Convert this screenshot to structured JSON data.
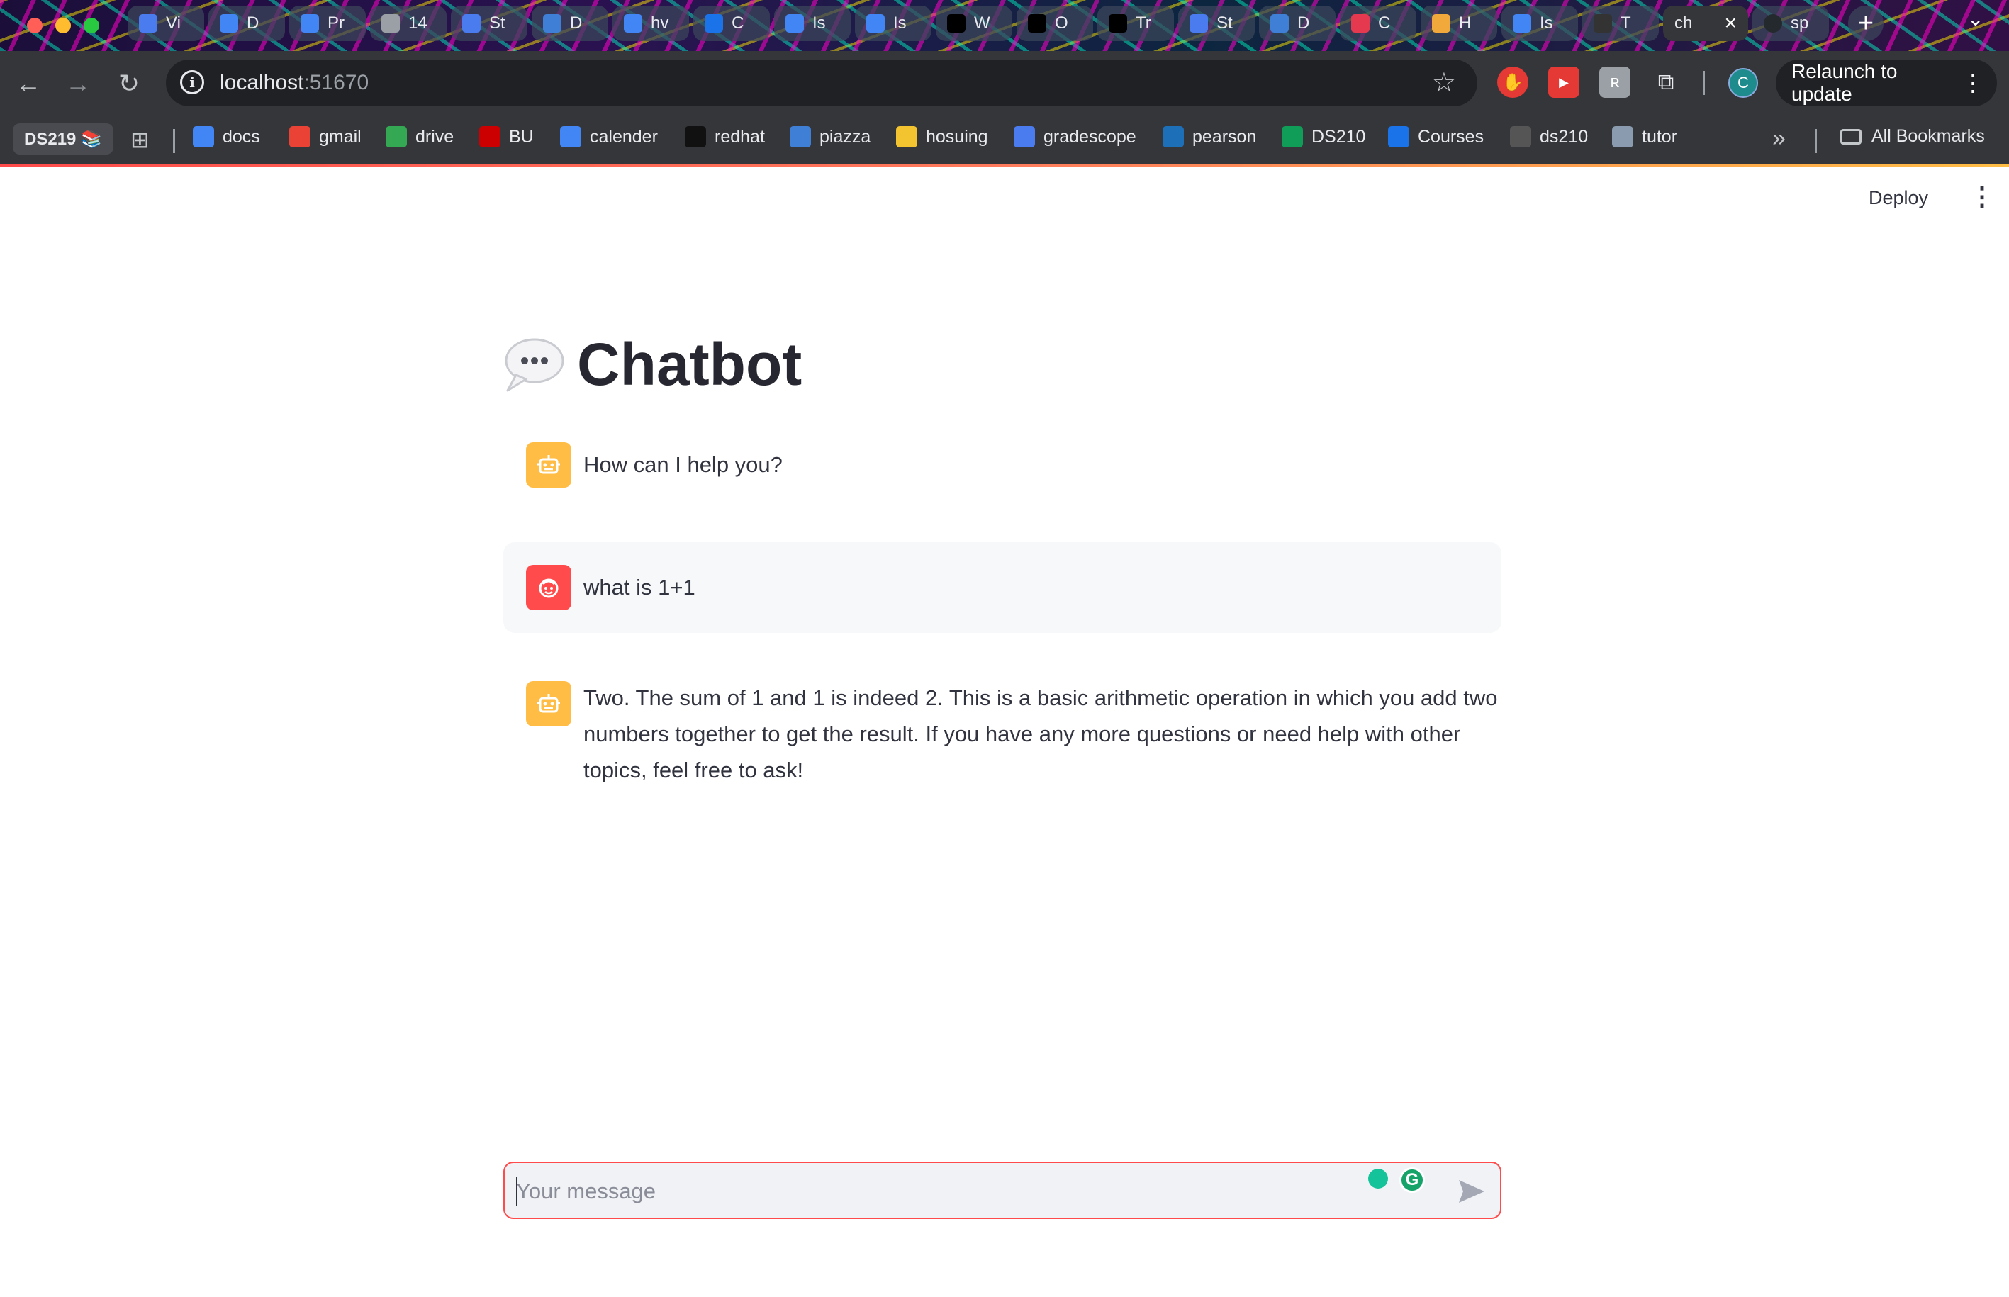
{
  "browser": {
    "tabs": [
      {
        "label": "Vi",
        "icon": "chart-bars-icon",
        "color": "#4a7cf0"
      },
      {
        "label": "D",
        "icon": "docs-icon",
        "color": "#4285f4"
      },
      {
        "label": "Pr",
        "icon": "docs-icon",
        "color": "#4285f4"
      },
      {
        "label": "14",
        "icon": "play-circle-icon",
        "color": "#9aa0a6"
      },
      {
        "label": "St",
        "icon": "chart-bars-icon",
        "color": "#4a7cf0"
      },
      {
        "label": "D",
        "icon": "piazza-icon",
        "color": "#3f7fd6"
      },
      {
        "label": "hv",
        "icon": "docs-icon",
        "color": "#4285f4"
      },
      {
        "label": "C",
        "icon": "courses-icon",
        "color": "#1a73e8"
      },
      {
        "label": "Is",
        "icon": "docs-icon",
        "color": "#4285f4"
      },
      {
        "label": "Is",
        "icon": "docs-icon",
        "color": "#4285f4"
      },
      {
        "label": "W",
        "icon": "notion-icon",
        "color": "#000000"
      },
      {
        "label": "O",
        "icon": "notion-icon",
        "color": "#000000"
      },
      {
        "label": "Tr",
        "icon": "notion-icon",
        "color": "#000000"
      },
      {
        "label": "St",
        "icon": "chart-bars-icon",
        "color": "#4a7cf0"
      },
      {
        "label": "D",
        "icon": "piazza-icon",
        "color": "#3f7fd6"
      },
      {
        "label": "C",
        "icon": "e-icon",
        "color": "#e53950"
      },
      {
        "label": "H",
        "icon": "link-icon",
        "color": "#f2a93b"
      },
      {
        "label": "Is",
        "icon": "docs-icon",
        "color": "#4285f4"
      },
      {
        "label": "T",
        "icon": "m-icon",
        "color": "#333333"
      }
    ],
    "active_tab": {
      "label": "ch"
    },
    "last_tab": {
      "label": "sp",
      "icon": "github-icon"
    },
    "url_host": "localhost",
    "url_port": ":51670",
    "relaunch_label": "Relaunch to update",
    "profile_initial": "C",
    "bookmark_group": "DS219 📚",
    "bookmarks": [
      {
        "label": "docs",
        "icon": "docs-icon",
        "color": "#4285f4"
      },
      {
        "label": "gmail",
        "icon": "gmail-icon",
        "color": "#ea4335"
      },
      {
        "label": "drive",
        "icon": "drive-icon",
        "color": "#34a853"
      },
      {
        "label": "BU",
        "icon": "bu-icon",
        "color": "#cc0000"
      },
      {
        "label": "calender",
        "icon": "calendar-icon",
        "color": "#4285f4"
      },
      {
        "label": "redhat",
        "icon": "redhat-icon",
        "color": "#111111"
      },
      {
        "label": "piazza",
        "icon": "piazza-icon",
        "color": "#3f7fd6"
      },
      {
        "label": "hosuing",
        "icon": "star-icon",
        "color": "#f4c430"
      },
      {
        "label": "gradescope",
        "icon": "chart-bars-icon",
        "color": "#4a7cf0"
      },
      {
        "label": "pearson",
        "icon": "pearson-icon",
        "color": "#1d6fb8"
      },
      {
        "label": "DS210",
        "icon": "sheets-icon",
        "color": "#0f9d58"
      },
      {
        "label": "Courses",
        "icon": "courses-icon",
        "color": "#1a73e8"
      },
      {
        "label": "ds210",
        "icon": "camera-icon",
        "color": "#555555"
      },
      {
        "label": "tutor",
        "icon": "tutor-icon",
        "color": "#8a9bb0"
      }
    ],
    "all_bookmarks_label": "All Bookmarks"
  },
  "app": {
    "deploy_label": "Deploy",
    "title_emoji": "speech-bubble-icon",
    "title": "Chatbot",
    "messages": [
      {
        "role": "assistant",
        "text": "How can I help you?"
      },
      {
        "role": "user",
        "text": "what is 1+1"
      },
      {
        "role": "assistant",
        "lines": [
          "Two. The sum of 1 and 1 is indeed 2. This is a basic arithmetic operation in which you add two",
          "numbers together to get the result. If you have any more questions or need help with other",
          "topics, feel free to ask!"
        ]
      }
    ],
    "input_placeholder": "Your message",
    "input_value": ""
  },
  "colors": {
    "accent": "#ff4b4b",
    "assistant_avatar": "#ffbd45",
    "user_avatar": "#ff4b4b",
    "text": "#31333f",
    "chrome_bg": "#35363a"
  }
}
